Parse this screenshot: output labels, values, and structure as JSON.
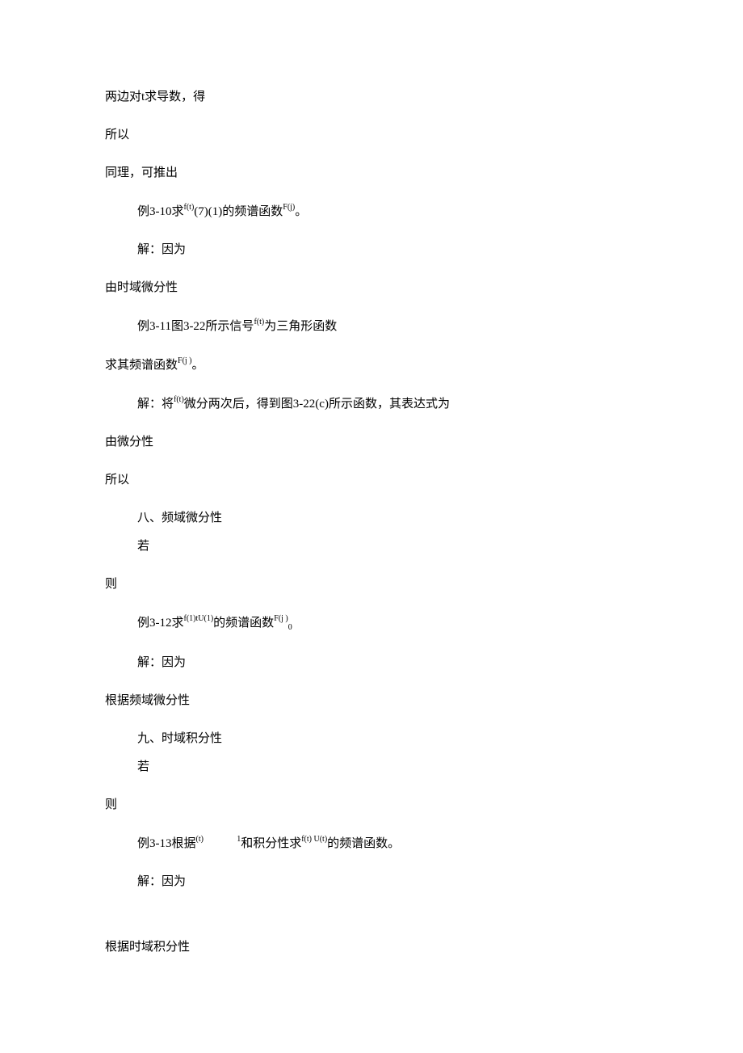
{
  "lines": {
    "l1": "两边对t求导数，得",
    "l2": "所以",
    "l3": "同理，可推出",
    "l4a": "例3-10求",
    "l4_sup1": "f(t)",
    "l4b": "(7)(1)的频谱函数",
    "l4_sup2": "F(j)",
    "l4c": "。",
    "l5": "解：因为",
    "l6": "由时域微分性",
    "l7a": "例3-11图3-22所示信号",
    "l7_sup": "f(t)",
    "l7b": "为三角形函数",
    "l8a": "求其频谱函数",
    "l8_sup": "F(j )",
    "l8b": "。",
    "l9a": "解：将",
    "l9_sup": "f(t)",
    "l9b": "微分两次后，得到图3-22(c)所示函数，其表达式为",
    "l10": "由微分性",
    "l11": "所以",
    "l12": "八、频域微分性",
    "l13": "若",
    "l14": "则",
    "l15a": "例3-12求",
    "l15_sup1": "f(1)",
    "l15_sup2": "tU(1)",
    "l15b": "的频谱函数",
    "l15_sup3": "F(j  )",
    "l15_sub": "0",
    "l16": "解：因为",
    "l17": "根据频域微分性",
    "l18": "九、时域积分性",
    "l19": "若",
    "l20": "则",
    "l21a": "例3-13根据",
    "l21_sup1": "(t)",
    "l21_gap": "           ",
    "l21_sup2": "1",
    "l21b": "和积分性求",
    "l21_sup3": "f(t)  U(t)",
    "l21c": "的频谱函数。",
    "l22": "解：因为",
    "l23": "根据时域积分性"
  }
}
